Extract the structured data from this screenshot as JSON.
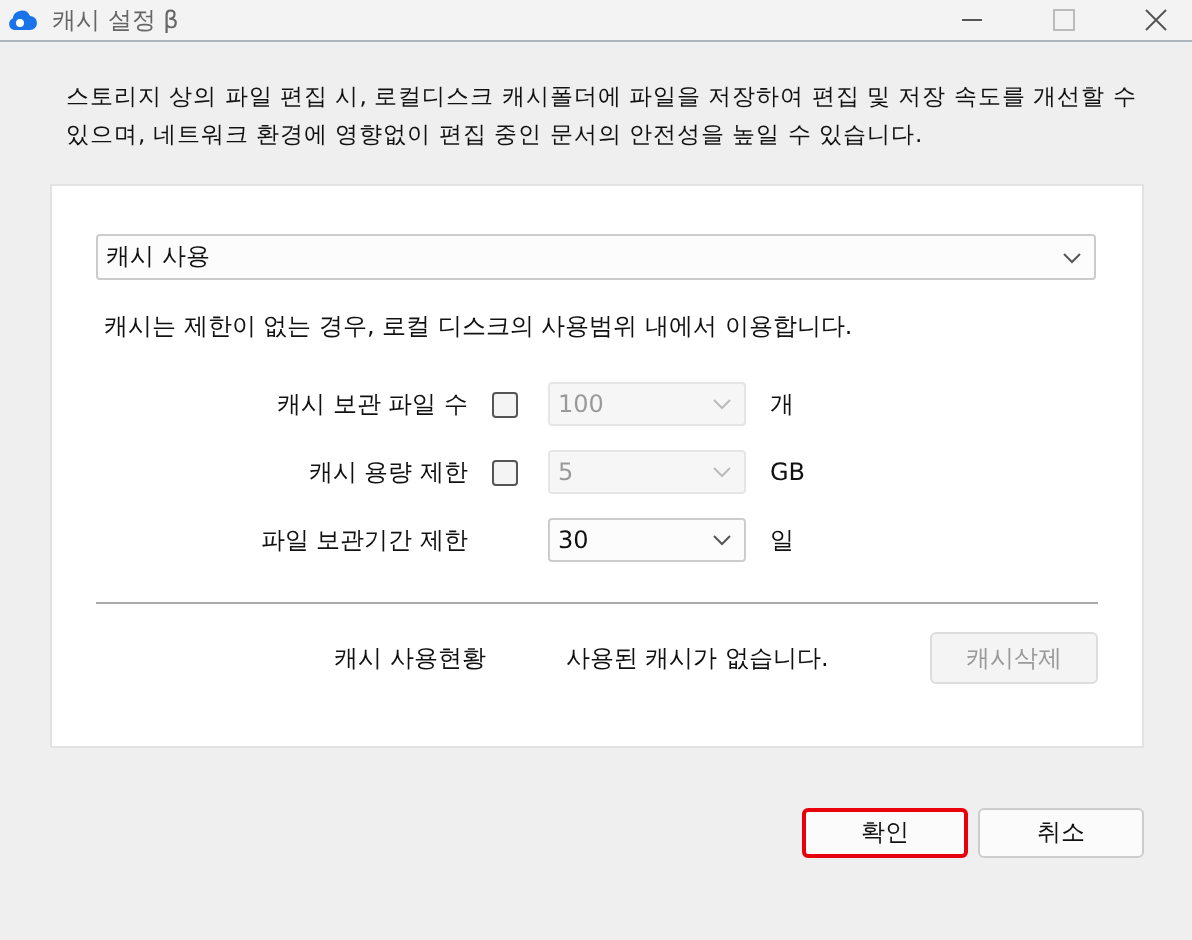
{
  "window": {
    "title": "캐시 설정 β"
  },
  "description": "스토리지 상의 파일 편집 시, 로컬디스크 캐시폴더에 파일을 저장하여 편집 및 저장 속도를 개선할 수 있으며, 네트워크 환경에 영향없이 편집 중인 문서의 안전성을 높일 수 있습니다.",
  "mode_select": {
    "value": "캐시 사용"
  },
  "info": "캐시는 제한이 없는 경우, 로컬 디스크의 사용범위 내에서 이용합니다.",
  "limits": [
    {
      "kind": "checkbox",
      "label": "캐시 보관 파일 수",
      "checked": false,
      "value": "100",
      "unit": "개"
    },
    {
      "kind": "checkbox",
      "label": "캐시 용량 제한",
      "checked": false,
      "value": "5",
      "unit": "GB"
    },
    {
      "kind": "plain",
      "label": "파일 보관기간 제한",
      "value": "30",
      "unit": "일"
    }
  ],
  "usage": {
    "label": "캐시 사용현황",
    "status": "사용된 캐시가 없습니다.",
    "button": {
      "label": "캐시삭제",
      "disabled": true
    }
  },
  "buttons": [
    {
      "label": "확인",
      "highlighted": true
    },
    {
      "label": "취소",
      "highlighted": false
    }
  ]
}
